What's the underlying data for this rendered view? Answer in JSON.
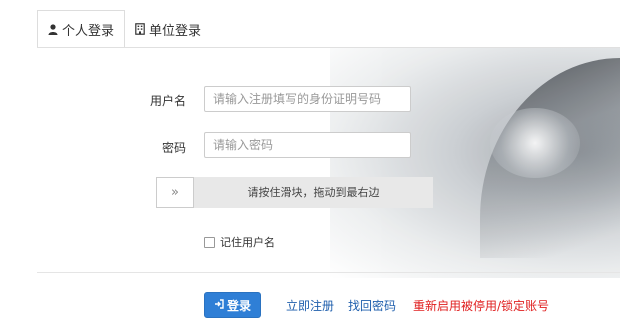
{
  "tabs": [
    {
      "label": "个人登录",
      "icon": "user-icon",
      "active": true
    },
    {
      "label": "单位登录",
      "icon": "building-icon",
      "active": false
    }
  ],
  "form": {
    "username_label": "用户名",
    "username_placeholder": "请输入注册填写的身份证明号码",
    "password_label": "密码",
    "password_placeholder": "请输入密码",
    "slider_handle": "»",
    "slider_text": "请按住滑块，拖动到最右边",
    "remember_label": "记住用户名"
  },
  "actions": {
    "login_label": "登录",
    "login_icon": "sign-in-icon",
    "register_link": "立即注册",
    "recover_link": "找回密码",
    "reactivate_link": "重新启用被停用/锁定账号"
  },
  "colors": {
    "primary": "#2f7fd6",
    "link": "#1f5fad",
    "danger": "#e02020"
  }
}
